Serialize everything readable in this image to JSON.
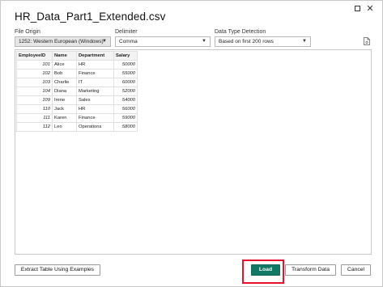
{
  "dialog": {
    "title": "HR_Data_Part1_Extended.csv"
  },
  "file_origin": {
    "label": "File Origin",
    "value": "1252: Western European (Windows)"
  },
  "delimiter": {
    "label": "Delimiter",
    "value": "Comma"
  },
  "data_type_detection": {
    "label": "Data Type Detection",
    "value": "Based on first 200 rows"
  },
  "table": {
    "headers": [
      "EmployeeID",
      "Name",
      "Department",
      "Salary"
    ],
    "rows": [
      [
        "101",
        "Alice",
        "HR",
        "50000"
      ],
      [
        "102",
        "Bob",
        "Finance",
        "55000"
      ],
      [
        "103",
        "Charlie",
        "IT",
        "60000"
      ],
      [
        "104",
        "Diana",
        "Marketing",
        "52000"
      ],
      [
        "109",
        "Irene",
        "Sales",
        "54000"
      ],
      [
        "110",
        "Jack",
        "HR",
        "56000"
      ],
      [
        "111",
        "Karen",
        "Finance",
        "59000"
      ],
      [
        "112",
        "Leo",
        "Operations",
        "58000"
      ]
    ]
  },
  "buttons": {
    "extract": "Extract Table Using Examples",
    "load": "Load",
    "transform": "Transform Data",
    "cancel": "Cancel"
  },
  "colors": {
    "load_button": "#117865",
    "highlight_border": "#e8102a"
  },
  "icons": [
    "maximize-icon",
    "close-icon",
    "chevron-down-icon",
    "file-settings-icon"
  ]
}
